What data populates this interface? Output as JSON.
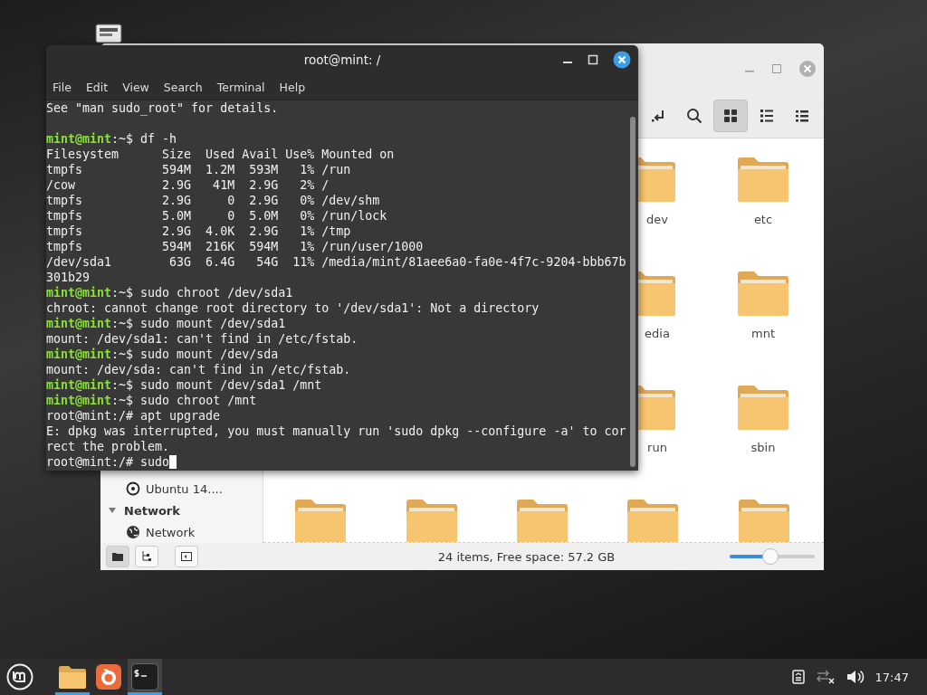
{
  "files_window": {
    "toolbar": [
      {
        "kind": "return",
        "selected": false
      },
      {
        "kind": "search",
        "selected": false
      },
      {
        "kind": "grid",
        "selected": true
      },
      {
        "kind": "list",
        "selected": false
      },
      {
        "kind": "compact",
        "selected": false
      }
    ],
    "sidebar": [
      {
        "kind": "item",
        "label": "Ubuntu 14...."
      },
      {
        "kind": "header",
        "label": "Network",
        "expanded": true
      },
      {
        "kind": "item-network",
        "label": "Network"
      }
    ],
    "rows": [
      {
        "items": [
          {
            "kind": "folder",
            "label": "dev",
            "clipped": true
          },
          {
            "kind": "folder",
            "label": "etc",
            "clipped": false
          }
        ]
      },
      {
        "items": [
          {
            "kind": "folder",
            "label": "edia",
            "clipped": true
          },
          {
            "kind": "folder",
            "label": "mnt",
            "clipped": false
          }
        ]
      },
      {
        "items": [
          {
            "kind": "folder",
            "label": "run",
            "clipped": true
          },
          {
            "kind": "folder",
            "label": "sbin",
            "clipped": false
          }
        ]
      },
      {
        "items": [
          {
            "kind": "folder"
          },
          {
            "kind": "folder"
          },
          {
            "kind": "folder"
          },
          {
            "kind": "folder"
          },
          {
            "kind": "folder"
          }
        ]
      }
    ],
    "status_buttons": [
      {
        "kind": "places",
        "selected": true
      },
      {
        "kind": "tree",
        "selected": false
      },
      {
        "kind": "sidebar",
        "selected": false
      }
    ],
    "status_text": "24 items, Free space: 57.2 GB",
    "zoom": {
      "level": 0.48
    }
  },
  "terminal": {
    "title": "root@mint: /",
    "menu": [
      "File",
      "Edit",
      "View",
      "Search",
      "Terminal",
      "Help"
    ],
    "lines": [
      {
        "kind": "output",
        "text": "See \"man sudo_root\" for details."
      },
      {
        "kind": "blank"
      },
      {
        "kind": "prompt",
        "user": "mint@mint",
        "rest": ":~$ df -h"
      },
      {
        "kind": "output",
        "text": "Filesystem      Size  Used Avail Use% Mounted on"
      },
      {
        "kind": "output",
        "text": "tmpfs           594M  1.2M  593M   1% /run"
      },
      {
        "kind": "output",
        "text": "/cow            2.9G   41M  2.9G   2% /"
      },
      {
        "kind": "output",
        "text": "tmpfs           2.9G     0  2.9G   0% /dev/shm"
      },
      {
        "kind": "output",
        "text": "tmpfs           5.0M     0  5.0M   0% /run/lock"
      },
      {
        "kind": "output",
        "text": "tmpfs           2.9G  4.0K  2.9G   1% /tmp"
      },
      {
        "kind": "output",
        "text": "tmpfs           594M  216K  594M   1% /run/user/1000"
      },
      {
        "kind": "output",
        "text": "/dev/sda1        63G  6.4G   54G  11% /media/mint/81aee6a0-fa0e-4f7c-9204-bbb67b"
      },
      {
        "kind": "output",
        "text": "301b29"
      },
      {
        "kind": "prompt",
        "user": "mint@mint",
        "rest": ":~$ sudo chroot /dev/sda1"
      },
      {
        "kind": "output",
        "text": "chroot: cannot change root directory to '/dev/sda1': Not a directory"
      },
      {
        "kind": "prompt",
        "user": "mint@mint",
        "rest": ":~$ sudo mount /dev/sda1"
      },
      {
        "kind": "output",
        "text": "mount: /dev/sda1: can't find in /etc/fstab."
      },
      {
        "kind": "prompt",
        "user": "mint@mint",
        "rest": ":~$ sudo mount /dev/sda"
      },
      {
        "kind": "output",
        "text": "mount: /dev/sda: can't find in /etc/fstab."
      },
      {
        "kind": "prompt",
        "user": "mint@mint",
        "rest": ":~$ sudo mount /dev/sda1 /mnt"
      },
      {
        "kind": "prompt",
        "user": "mint@mint",
        "rest": ":~$ sudo chroot /mnt"
      },
      {
        "kind": "output",
        "text": "root@mint:/# apt upgrade"
      },
      {
        "kind": "output",
        "text": "E: dpkg was interrupted, you must manually run 'sudo dpkg --configure -a' to cor"
      },
      {
        "kind": "output",
        "text": "rect the problem."
      },
      {
        "kind": "input",
        "text": "root@mint:/# sudo",
        "cursor": true
      }
    ]
  },
  "taskbar": {
    "apps": [
      {
        "kind": "files",
        "running": true,
        "selected": false
      },
      {
        "kind": "browser",
        "running": false,
        "selected": false
      },
      {
        "kind": "terminal",
        "running": true,
        "selected": true
      }
    ],
    "clock": "17:47"
  }
}
